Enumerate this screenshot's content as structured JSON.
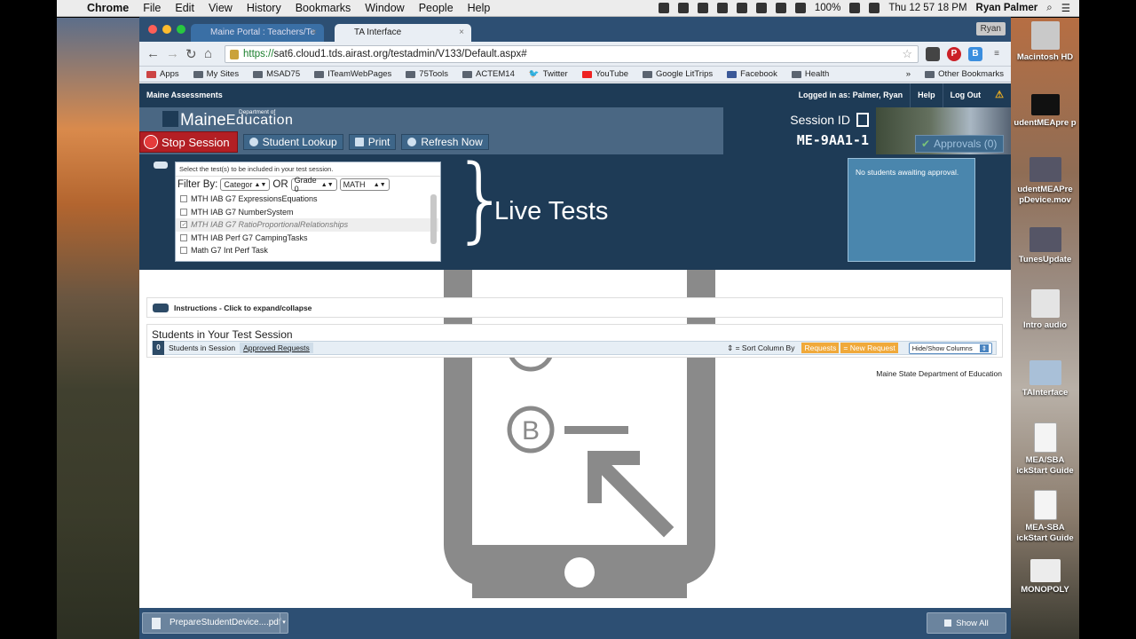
{
  "menubar": {
    "app": "Chrome",
    "items": [
      "File",
      "Edit",
      "View",
      "History",
      "Bookmarks",
      "Window",
      "People",
      "Help"
    ],
    "battery": "100%",
    "clock": "Thu 12 57 18 PM",
    "user": "Ryan Palmer"
  },
  "browser": {
    "tabs": [
      {
        "label": "Maine Portal : Teachers/Te"
      },
      {
        "label": "TA Interface"
      }
    ],
    "profile": "Ryan",
    "url_scheme": "https://",
    "url_rest": "sat6.cloud1.tds.airast.org/testadmin/V133/Default.aspx#",
    "bookmarks": [
      "Apps",
      "My Sites",
      "MSAD75",
      "ITeamWebPages",
      "75Tools",
      "ACTEM14",
      "Twitter",
      "YouTube",
      "Google LitTrips",
      "Facebook",
      "Health"
    ],
    "other_bookmarks": "Other Bookmarks"
  },
  "app_bar": {
    "title": "Maine Assessments",
    "logged_in": "Logged in as: Palmer, Ryan",
    "help": "Help",
    "logout": "Log Out"
  },
  "header": {
    "logo_maine": "Maine",
    "logo_dept": "Department of",
    "logo_edu": "Education",
    "stop_session": "Stop Session",
    "student_lookup": "Student Lookup",
    "print": "Print",
    "refresh": "Refresh Now",
    "session_label": "Session ID",
    "session_id": "ME-9AA1-1",
    "approvals": "Approvals (0)"
  },
  "test_select": {
    "hint": "Select the test(s) to be included in your test session.",
    "filter_by": "Filter By:",
    "or": "OR",
    "category": "Categor",
    "grade": "Grade 0",
    "subject": "MATH",
    "tests": [
      {
        "label": "MTH IAB G7 ExpressionsEquations",
        "checked": false
      },
      {
        "label": "MTH IAB G7 NumberSystem",
        "checked": false
      },
      {
        "label": "MTH IAB G7 RatioProportionalRelationships",
        "checked": true
      },
      {
        "label": "MTH IAB Perf G7 CampingTasks",
        "checked": false
      },
      {
        "label": "Math G7 Int Perf Task",
        "checked": false
      }
    ]
  },
  "live_tests": "Live Tests",
  "approval_panel": "No students awaiting approval.",
  "instructions": "Instructions - Click to expand/collapse",
  "students": {
    "title": "Students in Your Test Session",
    "count": "0",
    "in_session": "Students in Session",
    "approved": "Approved Requests",
    "sort": "= Sort Column By",
    "requests": "Requests",
    "new_request": "= New Request",
    "hide_show": "Hide/Show Columns"
  },
  "footer": "Maine State Department of Education",
  "downloads": {
    "file": "PrepareStudentDevice....pdf",
    "show_all": "Show All"
  },
  "desktop_icons": [
    {
      "label": "Macintosh HD"
    },
    {
      "label": "udentMEApre p"
    },
    {
      "label": "udentMEAPre pDevice.mov"
    },
    {
      "label": "TunesUpdate"
    },
    {
      "label": "Intro audio"
    },
    {
      "label": "TAInterface"
    },
    {
      "label": "MEA/SBA ickStart Guide"
    },
    {
      "label": "MEA-SBA ickStart Guide"
    },
    {
      "label": "MONOPOLY"
    }
  ],
  "colors": {
    "navy": "#1e3b56",
    "stop_red": "#b31f24",
    "approval_blue": "#4a86ad",
    "request_orange": "#f0a93a"
  }
}
